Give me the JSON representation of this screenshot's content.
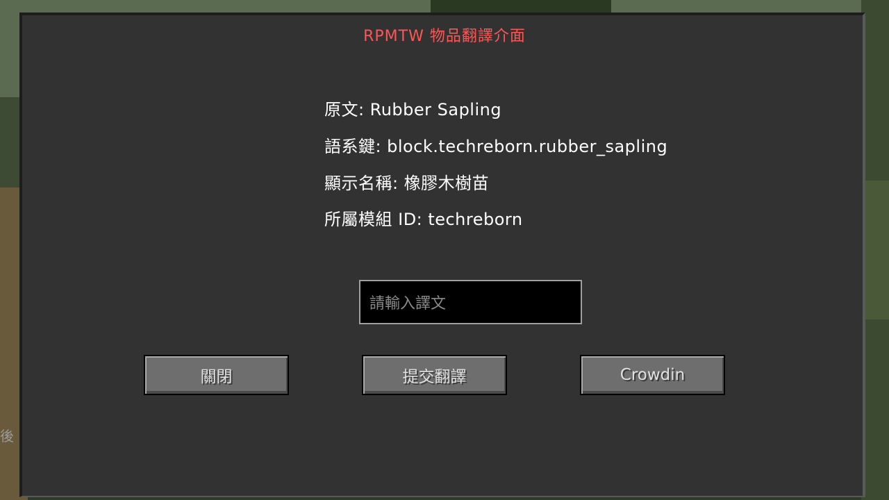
{
  "title": "RPMTW 物品翻譯介面",
  "info": {
    "original": {
      "label": "原文:",
      "value": "Rubber Sapling"
    },
    "lang_key": {
      "label": "語系鍵:",
      "value": "block.techreborn.rubber_sapling"
    },
    "display_name": {
      "label": "顯示名稱:",
      "value": "橡膠木樹苗"
    },
    "mod_id": {
      "label": "所屬模組 ID:",
      "value": "techreborn"
    }
  },
  "input": {
    "placeholder": "請輸入譯文"
  },
  "buttons": {
    "close": "關閉",
    "submit": "提交翻譯",
    "crowdin": "Crowdin"
  },
  "background_edge_text": "後",
  "colors": {
    "title": "#ff5555",
    "panel": "#323232",
    "text": "#ffffff",
    "button": "#6e6e6e"
  }
}
